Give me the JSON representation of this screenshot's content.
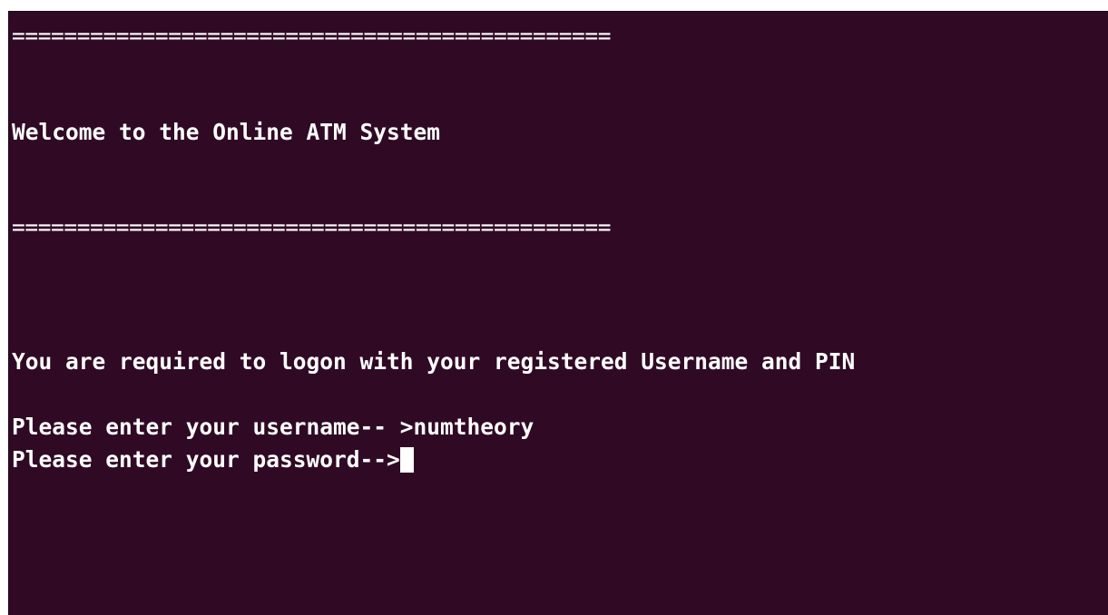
{
  "terminal": {
    "background_color": "#300a24",
    "text_color": "#ffffff",
    "rule_top": "==============================================",
    "welcome": "Welcome to the Online ATM System",
    "rule_bottom": "==============================================",
    "notice": "You are required to logon with your registered Username and PIN",
    "username_prompt": "Please enter your username-- >",
    "username_value": "numtheory",
    "password_prompt": "Please enter your password-->",
    "password_value": ""
  }
}
